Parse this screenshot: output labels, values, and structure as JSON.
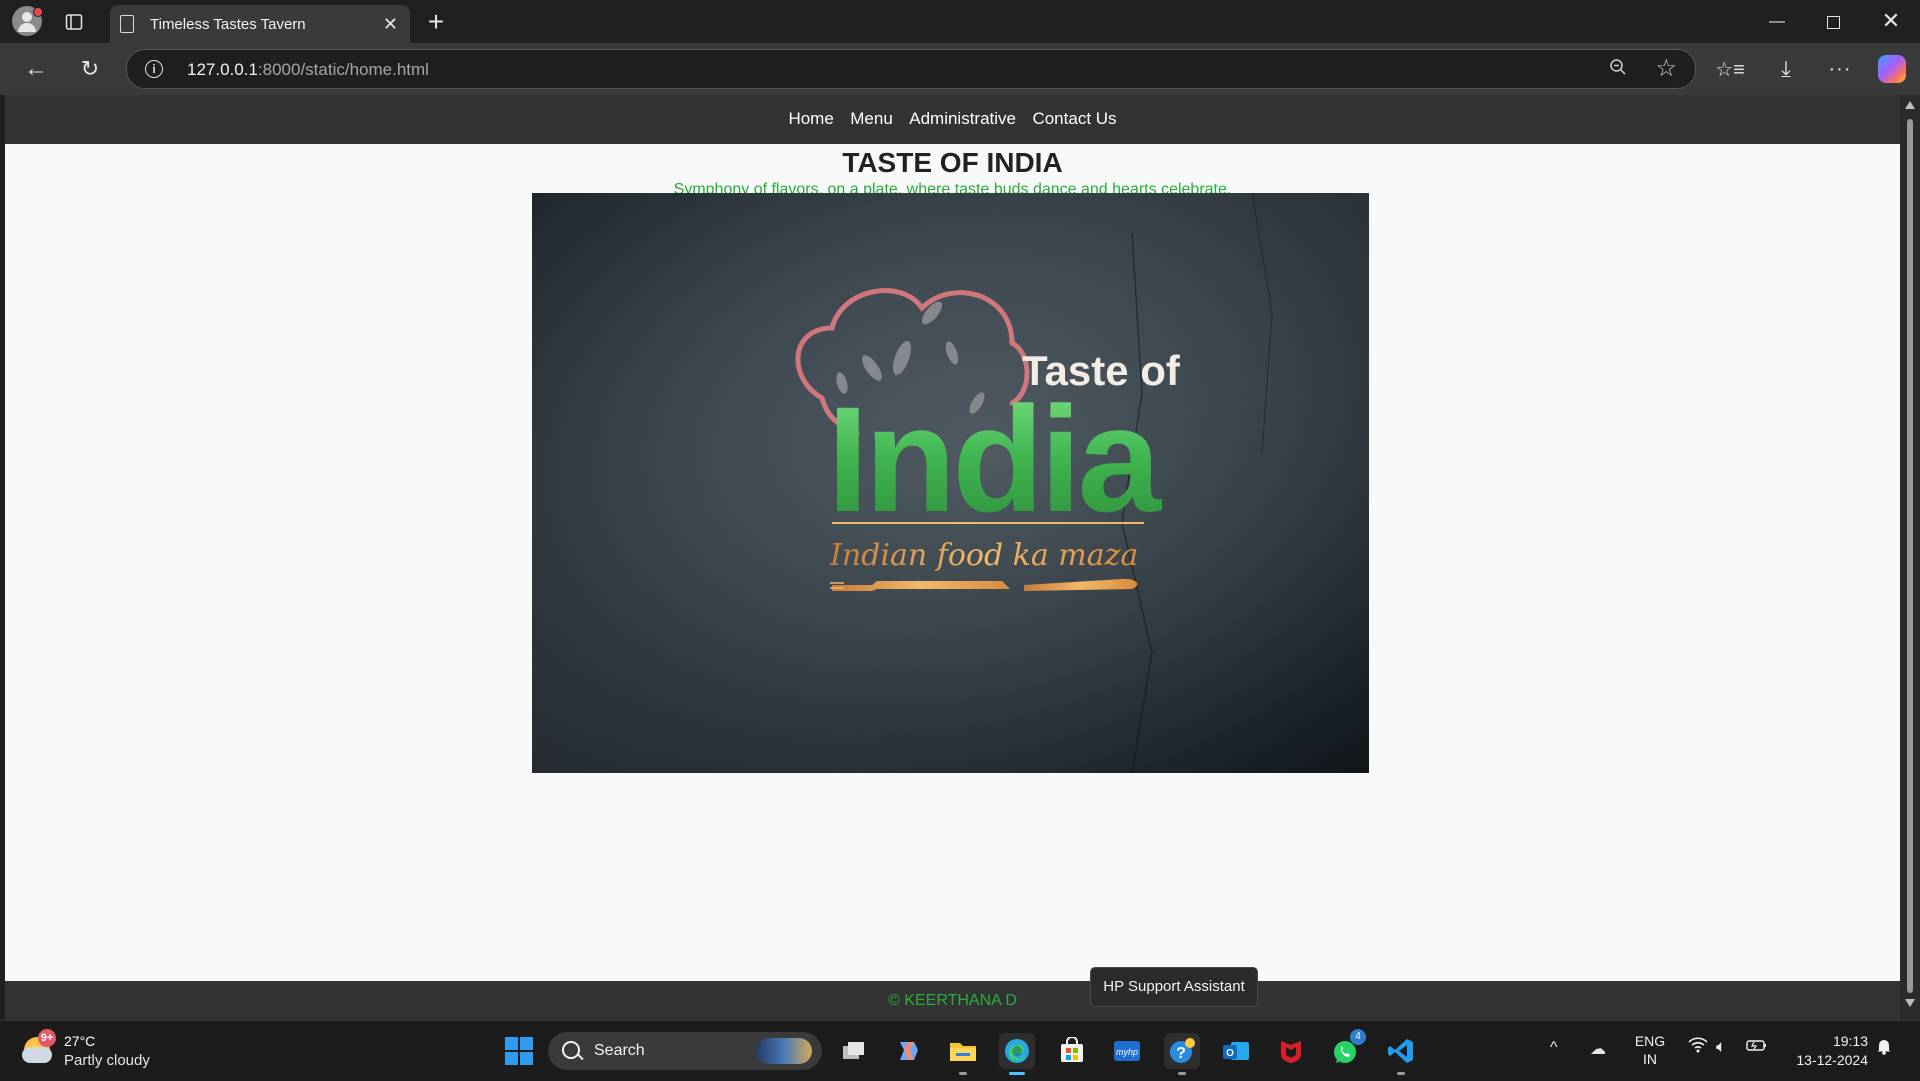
{
  "browser": {
    "tab_title": "Timeless Tastes Tavern",
    "url_host": "127.0.0.1",
    "url_rest": ":8000/static/home.html"
  },
  "site": {
    "nav": [
      "Home",
      "Menu",
      "Administrative",
      "Contact Us"
    ],
    "heading": "TASTE OF INDIA",
    "tagline": "Symphony of flavors, on a plate, where taste buds dance and hearts celebrate.",
    "logo": {
      "line1": "Taste of",
      "line2": "India",
      "line3": "Indian food ka maza"
    },
    "footer": "© KEERTHANA D"
  },
  "tooltip": "HP Support Assistant",
  "taskbar": {
    "weather_temp": "27°C",
    "weather_cond": "Partly cloudy",
    "weather_badge": "9+",
    "search_label": "Search",
    "lang_line1": "ENG",
    "lang_line2": "IN",
    "time": "19:13",
    "date": "13-12-2024",
    "whatsapp_badge": "4"
  },
  "colors": {
    "accent_green": "#2bac3a",
    "nav_bg": "#333333",
    "page_bg": "#f8f9f9"
  },
  "icons": [
    "profile-icon",
    "tabs-icon",
    "page-icon",
    "close-icon",
    "plus-icon",
    "minimize-icon",
    "maximize-icon",
    "back-icon",
    "reload-icon",
    "info-icon",
    "zoom-icon",
    "star-icon",
    "favorites-icon",
    "download-icon",
    "more-icon",
    "copilot-icon",
    "windows-start-icon",
    "search-icon",
    "task-view-icon",
    "copilot-app-icon",
    "file-explorer-icon",
    "edge-icon",
    "store-icon",
    "myhp-icon",
    "hp-support-icon",
    "outlook-icon",
    "mcafee-icon",
    "whatsapp-icon",
    "vscode-icon",
    "wifi-icon",
    "volume-icon",
    "battery-icon",
    "bell-icon"
  ]
}
